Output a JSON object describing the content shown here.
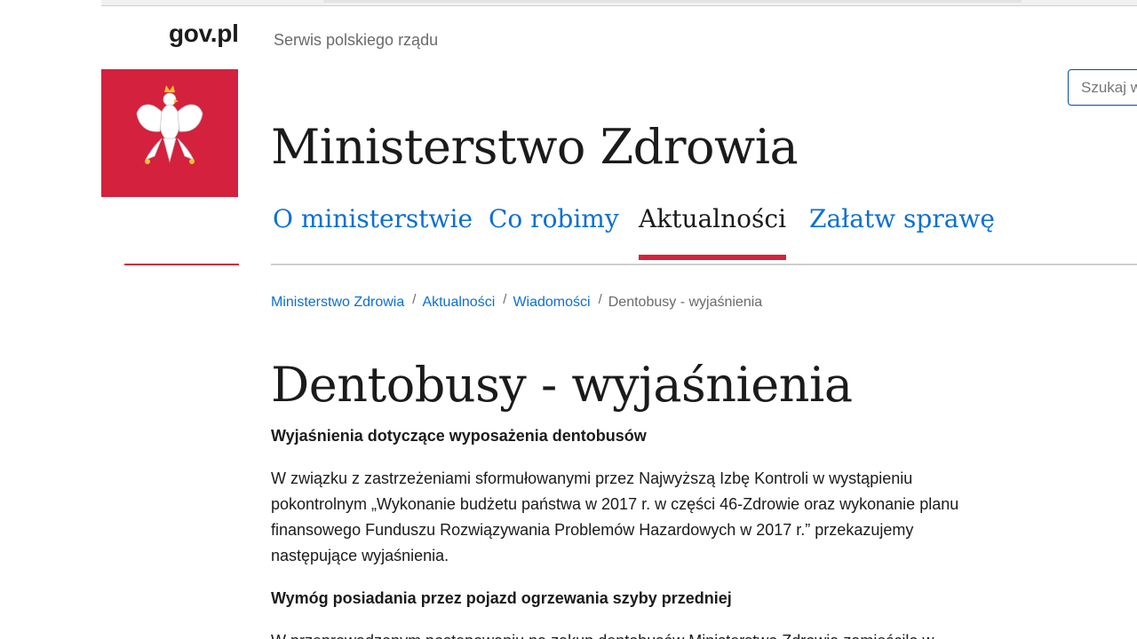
{
  "header": {
    "logo_text": "gov.pl",
    "tagline": "Serwis polskiego rządu"
  },
  "search": {
    "placeholder": "Szukaj w"
  },
  "ministry": {
    "title": "Ministerstwo Zdrowia"
  },
  "nav": {
    "items": [
      {
        "label": "O ministerstwie"
      },
      {
        "label": "Co robimy"
      },
      {
        "label": "Aktualności"
      },
      {
        "label": "Załatw sprawę"
      }
    ]
  },
  "breadcrumb": {
    "items": [
      {
        "label": "Ministerstwo Zdrowia"
      },
      {
        "label": "Aktualności"
      },
      {
        "label": "Wiadomości"
      }
    ],
    "current": "Dentobusy - wyjaśnienia",
    "separator": "/"
  },
  "article": {
    "title": "Dentobusy - wyjaśnienia",
    "lead": "Wyjaśnienia dotyczące wyposażenia dentobusów",
    "paragraph_1": "W związku z zastrzeżeniami sformułowanymi przez Najwyższą Izbę Kontroli w wystąpieniu pokontrolnym „Wykonanie budżetu państwa w 2017 r. w części 46-Zdrowie oraz wykonanie planu finansowego Funduszu Rozwiązywania Problemów Hazardowych w 2017 r.” przekazujemy następujące wyjaśnienia.",
    "subheading_1": "Wymóg posiadania przez pojazd ogrzewania szyby przedniej",
    "paragraph_2": "W przeprowadzonym postępowaniu na zakup dentobusów Ministerstwo Zdrowia zamieściło w"
  },
  "colors": {
    "accent_red": "#d4213d",
    "link_blue": "#0b6fd4",
    "search_border": "#0052a5"
  }
}
